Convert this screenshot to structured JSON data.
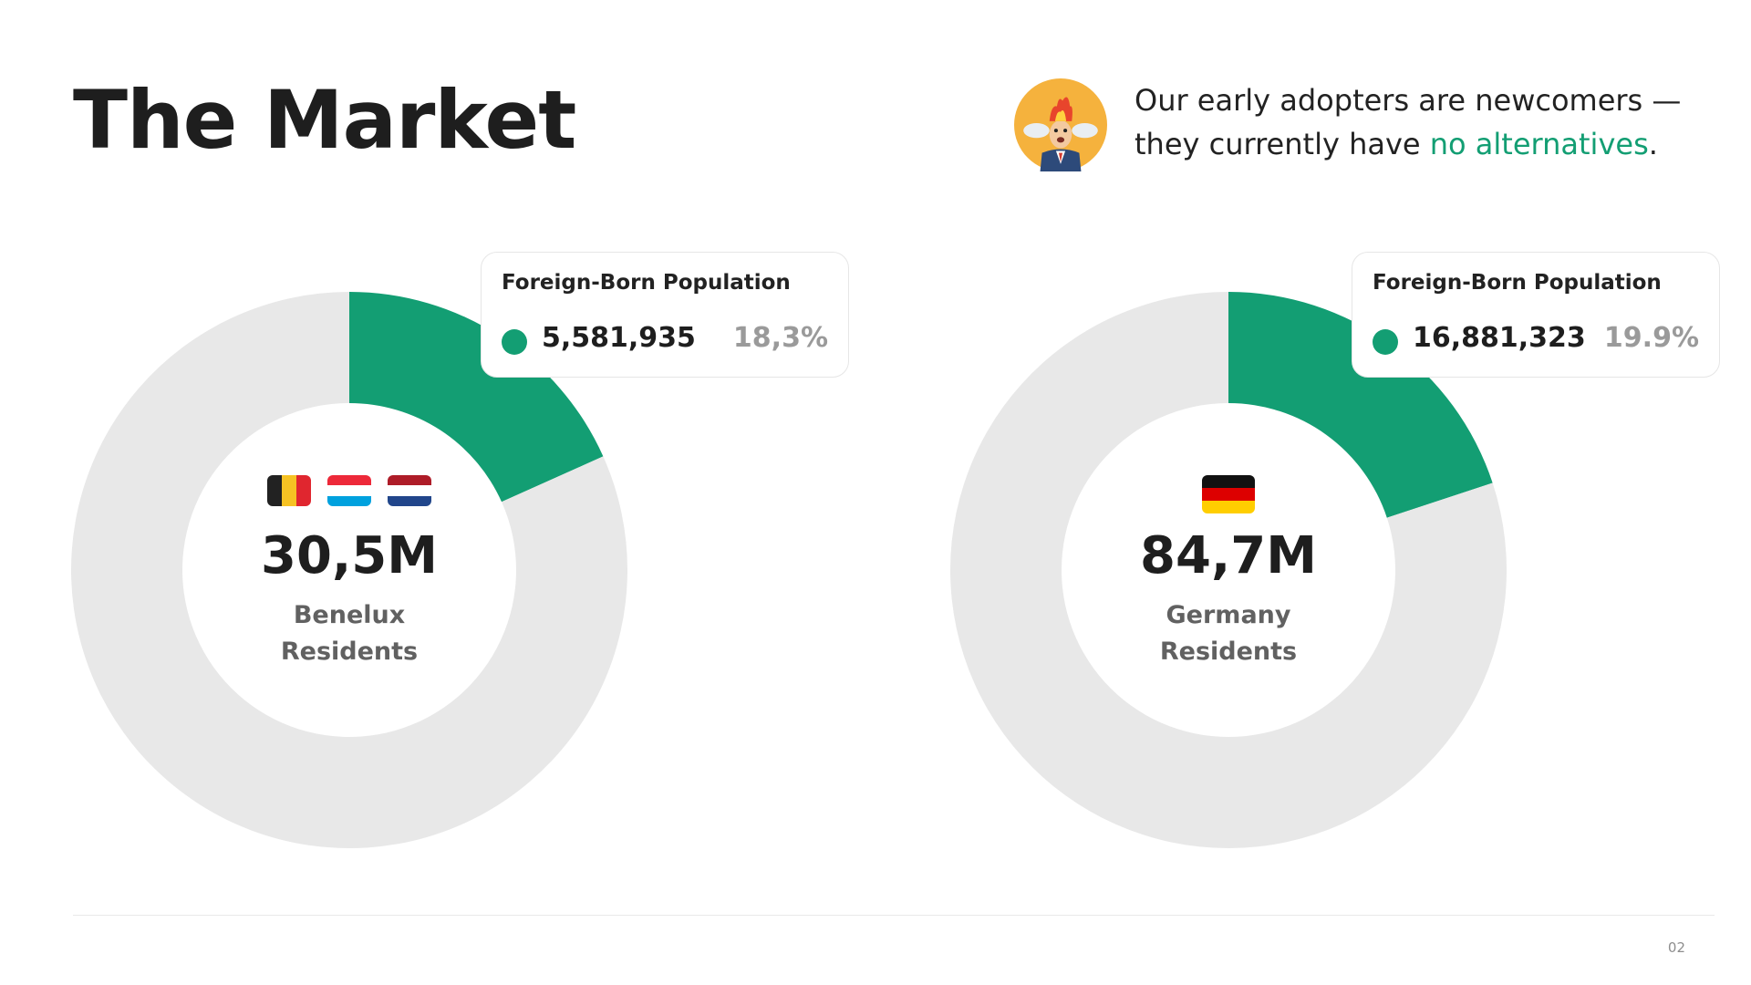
{
  "slide": {
    "title": "The Market",
    "tagline_part1": "Our early adopters are newcomers —",
    "tagline_part2": "they currently have",
    "tagline_highlight": "no alternatives",
    "tagline_end": ".",
    "page_number": "02"
  },
  "colors": {
    "accent": "#139e73",
    "ring_bg": "#e8e8e8",
    "text_dark": "#1e1e1e",
    "text_muted": "#9a9a9a"
  },
  "panels": [
    {
      "total_label": "30,5M",
      "region_line1": "Benelux",
      "region_line2": "Residents",
      "flags": [
        "belgium",
        "luxembourg",
        "netherlands"
      ],
      "card_title": "Foreign-Born Population",
      "foreign_value": "5,581,935",
      "foreign_pct": "18,3%"
    },
    {
      "total_label": "84,7M",
      "region_line1": "Germany",
      "region_line2": "Residents",
      "flags": [
        "germany"
      ],
      "card_title": "Foreign-Born Population",
      "foreign_value": "16,881,323",
      "foreign_pct": "19.9%"
    }
  ],
  "chart_data": [
    {
      "type": "pie",
      "categories": [
        "Foreign-Born Population",
        "Other"
      ],
      "values": [
        5581935,
        24918065
      ],
      "percent": [
        18.3,
        81.7
      ],
      "total": "30,5M"
    },
    {
      "type": "pie",
      "categories": [
        "Foreign-Born Population",
        "Other"
      ],
      "values": [
        16881323,
        67818677
      ],
      "percent": [
        19.9,
        80.1
      ],
      "total": "84,7M"
    }
  ]
}
